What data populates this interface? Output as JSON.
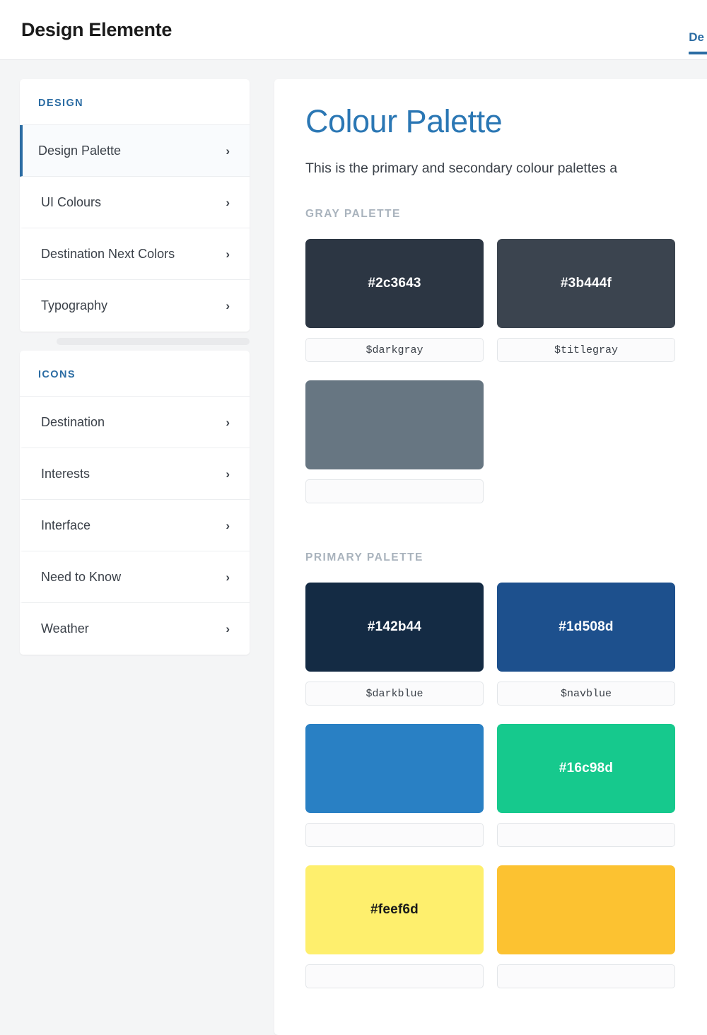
{
  "header": {
    "title": "Design Elemente",
    "tabs": [
      {
        "label": "De",
        "active": true
      }
    ]
  },
  "sidebar": {
    "groups": [
      {
        "title": "DESIGN",
        "items": [
          {
            "label": "Design Palette",
            "active": true,
            "icon": "chevron-right-icon"
          },
          {
            "label": "UI Colours",
            "active": false,
            "icon": "chevron-right-icon"
          },
          {
            "label": "Destination Next Colors",
            "active": false,
            "icon": "chevron-right-icon"
          },
          {
            "label": "Typography",
            "active": false,
            "icon": "chevron-right-icon"
          }
        ]
      },
      {
        "title": "ICONS",
        "items": [
          {
            "label": "Destination",
            "active": false,
            "icon": "chevron-right-icon"
          },
          {
            "label": "Interests",
            "active": false,
            "icon": "chevron-right-icon"
          },
          {
            "label": "Interface",
            "active": false,
            "icon": "chevron-right-icon"
          },
          {
            "label": "Need to Know",
            "active": false,
            "icon": "chevron-right-icon"
          },
          {
            "label": "Weather",
            "active": false,
            "icon": "chevron-right-icon"
          }
        ]
      }
    ]
  },
  "main": {
    "heading": "Colour Palette",
    "description": "This is the primary and secondary colour palettes a",
    "sections": [
      {
        "title": "GRAY PALETTE",
        "swatches": [
          {
            "hex": "#2c3643",
            "name": "$darkgray",
            "text_color": "#ffffff"
          },
          {
            "hex": "#3b444f",
            "name": "$titlegray",
            "text_color": "#ffffff"
          },
          {
            "hex": "#677682",
            "name": "",
            "text_color": "#ffffff"
          }
        ]
      },
      {
        "title": "PRIMARY PALETTE",
        "swatches": [
          {
            "hex": "#142b44",
            "name": "$darkblue",
            "text_color": "#ffffff"
          },
          {
            "hex": "#1d508d",
            "name": "$navblue",
            "text_color": "#ffffff"
          },
          {
            "hex": "#2980c4",
            "name": "",
            "text_color": "#ffffff"
          },
          {
            "hex": "#16c98d",
            "name": "",
            "text_color": "#ffffff"
          },
          {
            "hex": "#feef6d",
            "name": "",
            "text_color": "#1a1a1a"
          },
          {
            "hex": "#fcc231",
            "name": "",
            "text_color": "#1a1a1a"
          }
        ]
      }
    ]
  },
  "colors": {
    "accent_blue": "#2b6ca3",
    "heading_blue": "#2b77b4",
    "section_label_gray": "#a9b3bd",
    "page_background": "#f4f5f6",
    "card_background": "#ffffff"
  }
}
